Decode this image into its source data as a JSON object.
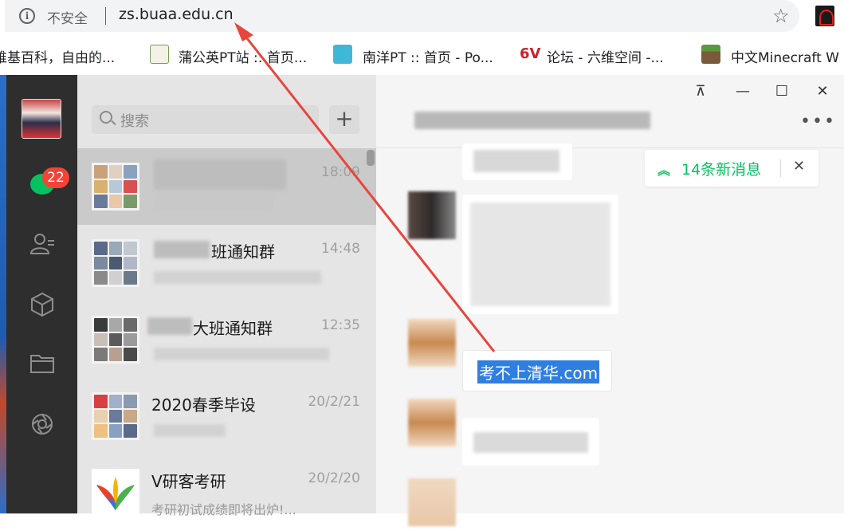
{
  "browser": {
    "security_label": "不安全",
    "url": "zs.buaa.edu.cn",
    "bookmarks": [
      {
        "label": "维基百科，自由的...",
        "icon": "wikipedia-icon"
      },
      {
        "label": "蒲公英PT站 :: 首页...",
        "icon": "dandelion-icon"
      },
      {
        "label": "南洋PT :: 首页 - Po...",
        "icon": "nypt-icon"
      },
      {
        "label": "论坛 - 六维空间 -...",
        "icon": "6v-icon"
      },
      {
        "label": "中文Minecraft W",
        "icon": "minecraft-icon"
      }
    ]
  },
  "wechat": {
    "unread_count": "22",
    "search_placeholder": "搜索",
    "add_label": "+",
    "sessions": [
      {
        "name": "",
        "time": "18:09",
        "preview": "",
        "active": true
      },
      {
        "name": "班通知群",
        "time": "14:48",
        "preview": "",
        "active": false
      },
      {
        "name": "大班通知群",
        "time": "12:35",
        "preview": "",
        "active": false
      },
      {
        "name": "2020春季毕设",
        "time": "20/2/21",
        "preview": "",
        "active": false
      },
      {
        "name": "V研客考研",
        "time": "20/2/20",
        "preview": "考研初试成绩即将出炉!...",
        "active": false
      }
    ],
    "window_controls": {
      "pin": "⊼",
      "minimize": "—",
      "maximize": "☐",
      "close": "✕"
    },
    "more_label": "•••",
    "new_messages": {
      "label": "14条新消息",
      "close": "✕"
    },
    "selected_message": "考不上清华.com"
  },
  "colors": {
    "accent_green": "#07c160",
    "badge_red": "#f44336",
    "annotation_arrow": "#e8453c",
    "selection_blue": "#2f7fe0"
  }
}
